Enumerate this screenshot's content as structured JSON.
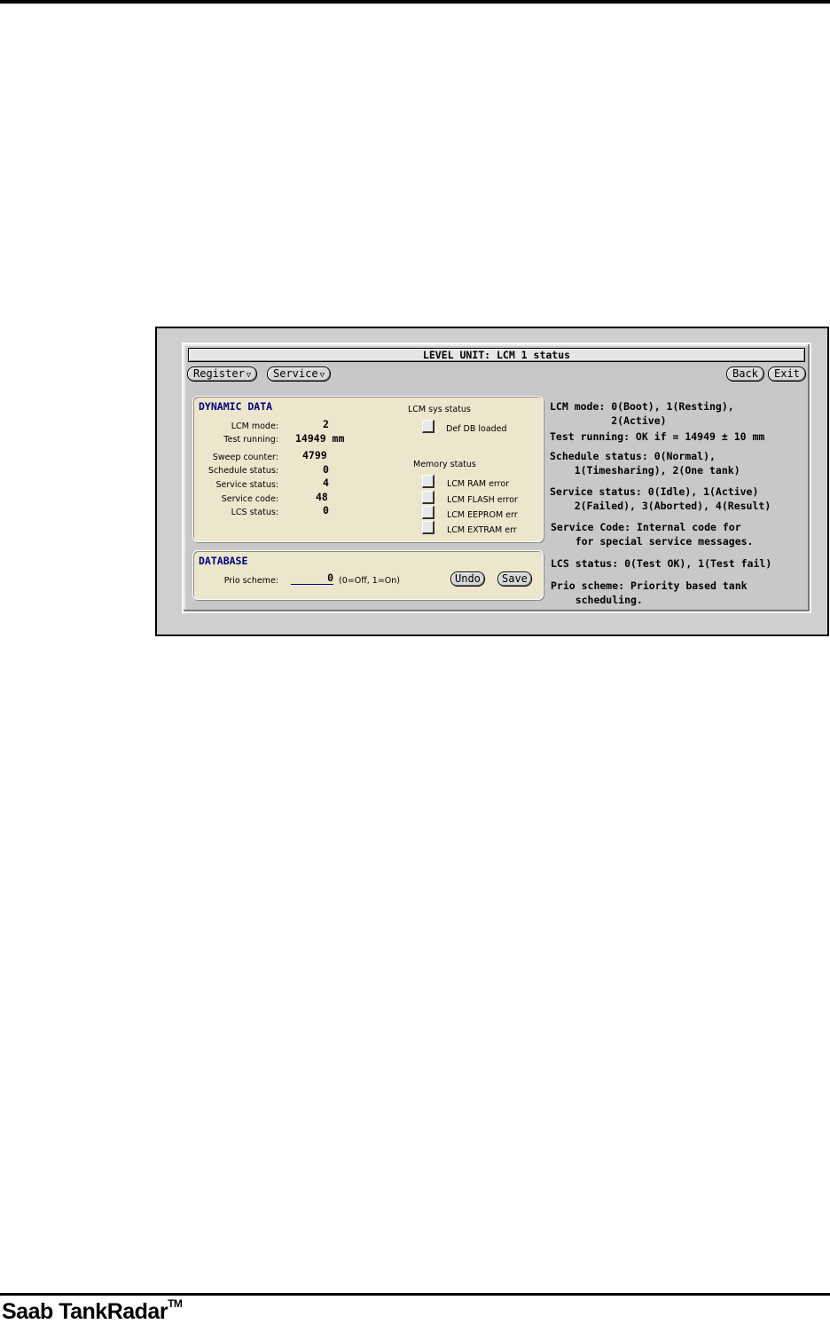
{
  "window": {
    "title": "LEVEL UNIT: LCM 1 status"
  },
  "toolbar": {
    "register_label": "Register",
    "service_label": "Service",
    "back_label": "Back",
    "exit_label": "Exit",
    "dropdown_glyph": "▽"
  },
  "dynamic_data": {
    "title": "DYNAMIC DATA",
    "fields": [
      {
        "label": "LCM mode:",
        "value": "2"
      },
      {
        "label": "Test running:",
        "value": "14949 mm"
      },
      {
        "label": "Sweep counter:",
        "value": "4799"
      },
      {
        "label": "Schedule status:",
        "value": "0"
      },
      {
        "label": "Service status:",
        "value": "4"
      },
      {
        "label": "Service code:",
        "value": "48"
      },
      {
        "label": "LCS status:",
        "value": "0"
      }
    ],
    "sys_status": {
      "heading": "LCM sys status",
      "items": [
        {
          "label": "Def DB loaded",
          "checked": false
        }
      ]
    },
    "memory_status": {
      "heading": "Memory status",
      "items": [
        {
          "label": "LCM RAM error",
          "checked": false
        },
        {
          "label": "LCM FLASH error",
          "checked": false
        },
        {
          "label": "LCM EEPROM err",
          "checked": false
        },
        {
          "label": "LCM EXTRAM err",
          "checked": false
        }
      ]
    }
  },
  "database": {
    "title": "DATABASE",
    "prio_label": "Prio scheme:",
    "prio_value": "0",
    "prio_hint": "(0=Off, 1=On)",
    "undo_label": "Undo",
    "save_label": "Save"
  },
  "help": [
    "LCM mode: 0(Boot), 1(Resting),\n          2(Active)",
    "Test running: OK if = 14949 ± 10 mm",
    "Schedule status: 0(Normal),\n    1(Timesharing), 2(One tank)",
    "Service status: 0(Idle), 1(Active)\n    2(Failed), 3(Aborted), 4(Result)",
    "Service Code: Internal code for\n    for special service messages.",
    "LCS status: 0(Test OK), 1(Test fail)",
    "Prio scheme: Priority based tank\n    scheduling."
  ],
  "footer": {
    "brand": "Saab TankRadar",
    "trademark": "TM"
  }
}
